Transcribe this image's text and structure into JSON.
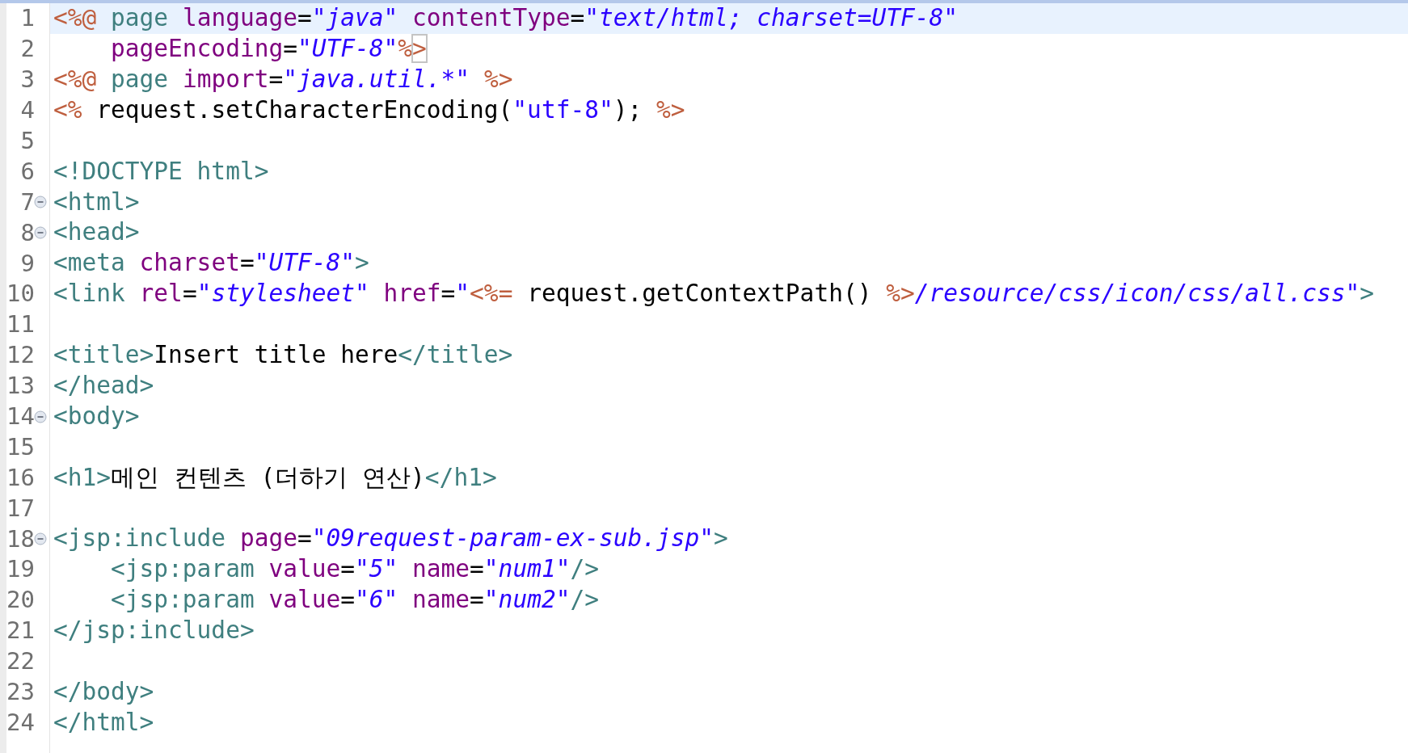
{
  "lines": [
    {
      "number": "1",
      "current": true,
      "foldable": false,
      "tokens": [
        {
          "text": "<%@",
          "kind": "jsp"
        },
        {
          "text": " page ",
          "kind": "tag"
        },
        {
          "text": "language",
          "kind": "attr"
        },
        {
          "text": "=",
          "kind": "plain"
        },
        {
          "text": "\"java\" ",
          "kind": "value"
        },
        {
          "text": "contentType",
          "kind": "attr"
        },
        {
          "text": "=",
          "kind": "plain"
        },
        {
          "text": "\"text/html; charset=UTF-8\"",
          "kind": "value"
        }
      ]
    },
    {
      "number": "2",
      "current": false,
      "foldable": false,
      "tokens": [
        {
          "text": "    pageEncoding",
          "kind": "attr"
        },
        {
          "text": "=",
          "kind": "plain"
        },
        {
          "text": "\"UTF-8\"",
          "kind": "value"
        },
        {
          "text": "%",
          "kind": "jsp"
        },
        {
          "text": ">",
          "kind": "match"
        }
      ]
    },
    {
      "number": "3",
      "current": false,
      "foldable": false,
      "tokens": [
        {
          "text": "<%@",
          "kind": "jsp"
        },
        {
          "text": " page ",
          "kind": "tag"
        },
        {
          "text": "import",
          "kind": "attr"
        },
        {
          "text": "=",
          "kind": "plain"
        },
        {
          "text": "\"java.util.*\" ",
          "kind": "value"
        },
        {
          "text": "%>",
          "kind": "jsp"
        }
      ]
    },
    {
      "number": "4",
      "current": false,
      "foldable": false,
      "tokens": [
        {
          "text": "<%",
          "kind": "jsp"
        },
        {
          "text": " request.setCharacterEncoding(",
          "kind": "plain"
        },
        {
          "text": "\"utf-8\"",
          "kind": "string"
        },
        {
          "text": "); ",
          "kind": "plain"
        },
        {
          "text": "%>",
          "kind": "jsp"
        }
      ]
    },
    {
      "number": "5",
      "current": false,
      "foldable": false
    },
    {
      "number": "6",
      "current": false,
      "foldable": false,
      "tokens": [
        {
          "text": "<!DOCTYPE html>",
          "kind": "tag"
        }
      ]
    },
    {
      "number": "7",
      "current": false,
      "foldable": true,
      "tokens": [
        {
          "text": "<html>",
          "kind": "tag"
        }
      ]
    },
    {
      "number": "8",
      "current": false,
      "foldable": true,
      "tokens": [
        {
          "text": "<head>",
          "kind": "tag"
        }
      ]
    },
    {
      "number": "9",
      "current": false,
      "foldable": false,
      "tokens": [
        {
          "text": "<meta ",
          "kind": "tag"
        },
        {
          "text": "charset",
          "kind": "attr"
        },
        {
          "text": "=",
          "kind": "plain"
        },
        {
          "text": "\"UTF-8\"",
          "kind": "value"
        },
        {
          "text": ">",
          "kind": "tag"
        }
      ]
    },
    {
      "number": "10",
      "current": false,
      "foldable": false,
      "tokens": [
        {
          "text": "<link ",
          "kind": "tag"
        },
        {
          "text": "rel",
          "kind": "attr"
        },
        {
          "text": "=",
          "kind": "plain"
        },
        {
          "text": "\"stylesheet\" ",
          "kind": "value"
        },
        {
          "text": "href",
          "kind": "attr"
        },
        {
          "text": "=",
          "kind": "plain"
        },
        {
          "text": "\"",
          "kind": "value"
        },
        {
          "text": "<%=",
          "kind": "jsp"
        },
        {
          "text": " request.getContextPath() ",
          "kind": "plain"
        },
        {
          "text": "%>",
          "kind": "jsp"
        },
        {
          "text": "/resource/css/icon/css/all.css\"",
          "kind": "value"
        },
        {
          "text": ">",
          "kind": "tag"
        }
      ]
    },
    {
      "number": "11",
      "current": false,
      "foldable": false
    },
    {
      "number": "12",
      "current": false,
      "foldable": false,
      "tokens": [
        {
          "text": "<title>",
          "kind": "tag"
        },
        {
          "text": "Insert title here",
          "kind": "plain"
        },
        {
          "text": "</title>",
          "kind": "tag"
        }
      ]
    },
    {
      "number": "13",
      "current": false,
      "foldable": false,
      "tokens": [
        {
          "text": "</head>",
          "kind": "tag"
        }
      ]
    },
    {
      "number": "14",
      "current": false,
      "foldable": true,
      "tokens": [
        {
          "text": "<body>",
          "kind": "tag"
        }
      ]
    },
    {
      "number": "15",
      "current": false,
      "foldable": false
    },
    {
      "number": "16",
      "current": false,
      "foldable": false,
      "tokens": [
        {
          "text": "<h1>",
          "kind": "tag"
        },
        {
          "text": "메인 컨텐츠 (더하기 연산)",
          "kind": "plain"
        },
        {
          "text": "</h1>",
          "kind": "tag"
        }
      ]
    },
    {
      "number": "17",
      "current": false,
      "foldable": false
    },
    {
      "number": "18",
      "current": false,
      "foldable": true,
      "tokens": [
        {
          "text": "<jsp:include ",
          "kind": "tag"
        },
        {
          "text": "page",
          "kind": "attr"
        },
        {
          "text": "=",
          "kind": "plain"
        },
        {
          "text": "\"09request-param-ex-sub.jsp\"",
          "kind": "value"
        },
        {
          "text": ">",
          "kind": "tag"
        }
      ]
    },
    {
      "number": "19",
      "current": false,
      "foldable": false,
      "tokens": [
        {
          "text": "    <jsp:param ",
          "kind": "tag"
        },
        {
          "text": "value",
          "kind": "attr"
        },
        {
          "text": "=",
          "kind": "plain"
        },
        {
          "text": "\"5\" ",
          "kind": "value"
        },
        {
          "text": "name",
          "kind": "attr"
        },
        {
          "text": "=",
          "kind": "plain"
        },
        {
          "text": "\"num1\"",
          "kind": "value"
        },
        {
          "text": "/>",
          "kind": "tag"
        }
      ]
    },
    {
      "number": "20",
      "current": false,
      "foldable": false,
      "tokens": [
        {
          "text": "    <jsp:param ",
          "kind": "tag"
        },
        {
          "text": "value",
          "kind": "attr"
        },
        {
          "text": "=",
          "kind": "plain"
        },
        {
          "text": "\"6\" ",
          "kind": "value"
        },
        {
          "text": "name",
          "kind": "attr"
        },
        {
          "text": "=",
          "kind": "plain"
        },
        {
          "text": "\"num2\"",
          "kind": "value"
        },
        {
          "text": "/>",
          "kind": "tag"
        }
      ]
    },
    {
      "number": "21",
      "current": false,
      "foldable": false,
      "tokens": [
        {
          "text": "</jsp:include>",
          "kind": "tag"
        }
      ]
    },
    {
      "number": "22",
      "current": false,
      "foldable": false
    },
    {
      "number": "23",
      "current": false,
      "foldable": false,
      "tokens": [
        {
          "text": "</body>",
          "kind": "tag"
        }
      ]
    },
    {
      "number": "24",
      "current": false,
      "foldable": false,
      "tokens": [
        {
          "text": "</html>",
          "kind": "tag"
        }
      ]
    }
  ]
}
